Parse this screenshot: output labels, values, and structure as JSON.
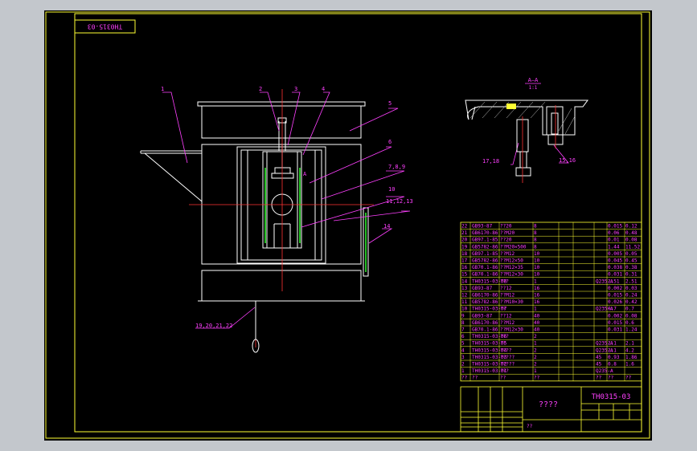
{
  "drawing": {
    "rotated_code": "TH0315-03",
    "section_label": "A—A",
    "section_scale": "1:1",
    "section_mark": "A",
    "title": "????",
    "drawing_code": "TH0315-03",
    "designer_label": "??"
  },
  "callouts": [
    "1",
    "2",
    "3",
    "4",
    "5",
    "6",
    "7,8,9",
    "10",
    "11,12,13",
    "14",
    "17,18",
    "15,16",
    "19,20,21,22"
  ],
  "parts_list": [
    [
      "22",
      "GB93-87",
      "??20",
      "8",
      "",
      "",
      "0.015",
      "0.12"
    ],
    [
      "21",
      "GB6170-86",
      "??M20",
      "8",
      "",
      "",
      "0.06",
      "0.48"
    ],
    [
      "20",
      "GB97.1-85",
      "??20",
      "8",
      "",
      "",
      "0.01",
      "0.08"
    ],
    [
      "19",
      "GB5782-86",
      "??M20×500",
      "8",
      "",
      "",
      "1.44",
      "11.52"
    ],
    [
      "18",
      "GB97.1-85",
      "??M12",
      "10",
      "",
      "",
      "0.005",
      "0.05"
    ],
    [
      "17",
      "GB5782-86",
      "??M12×50",
      "10",
      "",
      "",
      "0.045",
      "0.45"
    ],
    [
      "16",
      "GB70.1-86",
      "??M12×35",
      "10",
      "",
      "",
      "0.038",
      "0.38"
    ],
    [
      "15",
      "GB70.1-86",
      "??M12×30",
      "10",
      "",
      "",
      "0.031",
      "0.31"
    ],
    [
      "14",
      "TH0315-03-08",
      "???",
      "1",
      "",
      "Q235-A",
      "2.51",
      "2.51"
    ],
    [
      "13",
      "GB93-87",
      "??12",
      "16",
      "",
      "",
      "0.002",
      "0.03"
    ],
    [
      "12",
      "GB6170-86",
      "??M12",
      "16",
      "",
      "",
      "0.015",
      "0.24"
    ],
    [
      "11",
      "GB5782-86",
      "??M10×30",
      "16",
      "",
      "",
      "0.026",
      "0.42"
    ],
    [
      "10",
      "TH0315-03-07",
      "??",
      "1",
      "",
      "Q235-A",
      "0.7",
      "0.7"
    ],
    [
      "9",
      "GB93-87",
      "??12",
      "40",
      "",
      "",
      "0.002",
      "0.08"
    ],
    [
      "8",
      "GB6170-86",
      "??M12",
      "40",
      "",
      "",
      "0.015",
      "0.6"
    ],
    [
      "7",
      "GB70.1-86",
      "??M12×30",
      "40",
      "",
      "",
      "0.031",
      "1.24"
    ],
    [
      "6",
      "TH0315-03-06",
      "???",
      "2",
      "",
      "",
      "",
      ""
    ],
    [
      "5",
      "TH0315-03-05",
      "??",
      "1",
      "",
      "Q235-A",
      "2.1",
      "2.1"
    ],
    [
      "4",
      "TH0315-03-04",
      "????",
      "2",
      "",
      "Q235-A",
      "2.1",
      "4.2"
    ],
    [
      "3",
      "TH0315-03-03",
      "?????",
      "2",
      "",
      "45",
      "0.93",
      "1.86"
    ],
    [
      "2",
      "TH0315-03-02",
      "?????",
      "2",
      "",
      "45",
      "0.8",
      "1.6"
    ],
    [
      "1",
      "TH0315-03-01",
      "???",
      "1",
      "",
      "Q235-A",
      "",
      ""
    ]
  ],
  "parts_header": [
    "??",
    "??",
    "??",
    "??",
    "",
    "??",
    "??",
    "??"
  ]
}
